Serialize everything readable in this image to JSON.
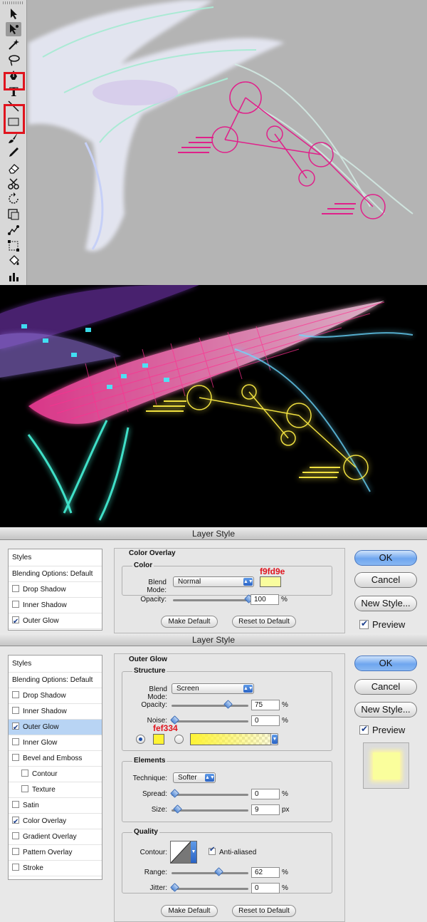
{
  "colors": {
    "canvas_gray": "#b4b4b4",
    "highlight_red": "#e0141e",
    "guide_magenta": "#e0208a",
    "guide_yellow": "#f0e040",
    "overlay_color": "#f9fd9e",
    "glow_color": "#fef334",
    "selected_row": "#b8d4f4"
  },
  "toolbar": {
    "tools": [
      {
        "icon": "move-arrow-icon"
      },
      {
        "icon": "direct-selection-icon"
      },
      {
        "icon": "magic-wand-icon"
      },
      {
        "icon": "lasso-icon"
      },
      {
        "icon": "pen-icon",
        "highlighted": true
      },
      {
        "icon": "type-icon",
        "glyph": "T"
      },
      {
        "icon": "line-tool-icon",
        "highlighted": true
      },
      {
        "icon": "rectangle-tool-icon",
        "highlighted": true
      },
      {
        "icon": "brush-icon"
      },
      {
        "icon": "pencil-icon"
      },
      {
        "icon": "eraser-icon"
      },
      {
        "icon": "scissors-icon"
      },
      {
        "icon": "rotate-icon"
      },
      {
        "icon": "scale-icon"
      },
      {
        "icon": "warp-icon"
      },
      {
        "icon": "free-transform-icon"
      },
      {
        "icon": "paint-bucket-icon"
      },
      {
        "icon": "graph-icon"
      }
    ]
  },
  "dialog1": {
    "title": "Layer Style",
    "styles_header": "Styles",
    "list": [
      {
        "label": "Blending Options: Default",
        "checkbox": false
      },
      {
        "label": "Drop Shadow",
        "checkbox": true,
        "checked": false
      },
      {
        "label": "Inner Shadow",
        "checkbox": true,
        "checked": false
      },
      {
        "label": "Outer Glow",
        "checkbox": true,
        "checked": true
      }
    ],
    "panel_title": "Color Overlay",
    "group_title": "Color",
    "blend_mode_label": "Blend Mode:",
    "blend_mode_value": "Normal",
    "color_annotation": "f9fd9e",
    "opacity_label": "Opacity:",
    "opacity_value": "100",
    "opacity_fraction": 1.0,
    "unit_percent": "%",
    "make_default": "Make Default",
    "reset_default": "Reset to Default",
    "ok": "OK",
    "cancel": "Cancel",
    "new_style": "New Style...",
    "preview": "Preview"
  },
  "dialog2": {
    "title": "Layer Style",
    "styles_header": "Styles",
    "list": [
      {
        "label": "Blending Options: Default",
        "checkbox": false
      },
      {
        "label": "Drop Shadow",
        "checkbox": true,
        "checked": false
      },
      {
        "label": "Inner Shadow",
        "checkbox": true,
        "checked": false
      },
      {
        "label": "Outer Glow",
        "checkbox": true,
        "checked": true,
        "selected": true
      },
      {
        "label": "Inner Glow",
        "checkbox": true,
        "checked": false
      },
      {
        "label": "Bevel and Emboss",
        "checkbox": true,
        "checked": false
      },
      {
        "label": "Contour",
        "checkbox": true,
        "checked": false,
        "indent": true
      },
      {
        "label": "Texture",
        "checkbox": true,
        "checked": false,
        "indent": true
      },
      {
        "label": "Satin",
        "checkbox": true,
        "checked": false
      },
      {
        "label": "Color Overlay",
        "checkbox": true,
        "checked": true
      },
      {
        "label": "Gradient Overlay",
        "checkbox": true,
        "checked": false
      },
      {
        "label": "Pattern Overlay",
        "checkbox": true,
        "checked": false
      },
      {
        "label": "Stroke",
        "checkbox": true,
        "checked": false
      }
    ],
    "panel_title": "Outer Glow",
    "structure_title": "Structure",
    "blend_mode_label": "Blend Mode:",
    "blend_mode_value": "Screen",
    "opacity_label": "Opacity:",
    "opacity_value": "75",
    "opacity_fraction": 0.75,
    "noise_label": "Noise:",
    "noise_value": "0",
    "noise_fraction": 0,
    "color_annotation": "fef334",
    "elements_title": "Elements",
    "technique_label": "Technique:",
    "technique_value": "Softer",
    "spread_label": "Spread:",
    "spread_value": "0",
    "spread_fraction": 0,
    "size_label": "Size:",
    "size_value": "9",
    "size_fraction": 0.04,
    "unit_px": "px",
    "quality_title": "Quality",
    "contour_label": "Contour:",
    "anti_aliased": "Anti-aliased",
    "range_label": "Range:",
    "range_value": "62",
    "range_fraction": 0.62,
    "jitter_label": "Jitter:",
    "jitter_value": "0",
    "jitter_fraction": 0,
    "unit_percent": "%",
    "make_default": "Make Default",
    "reset_default": "Reset to Default",
    "ok": "OK",
    "cancel": "Cancel",
    "new_style": "New Style...",
    "preview": "Preview"
  }
}
